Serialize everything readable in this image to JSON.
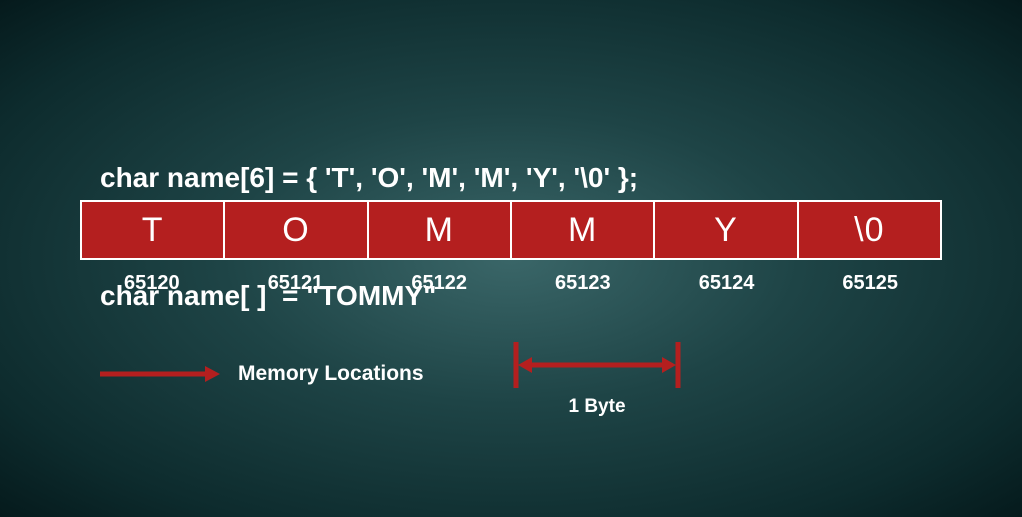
{
  "code": {
    "line1": "char name[6] = { 'T', 'O', 'M', 'M', 'Y', '\\0' };",
    "line2": "char name[ ]  = \"TOMMY\""
  },
  "cells": [
    "T",
    "O",
    "M",
    "M",
    "Y",
    "\\0"
  ],
  "addresses": [
    "65120",
    "65121",
    "65122",
    "65123",
    "65124",
    "65125"
  ],
  "legend": {
    "label": "Memory Locations"
  },
  "byte_span": {
    "label": "1 Byte"
  },
  "colors": {
    "cell_bg": "#b41f1f",
    "arrow": "#b41f1f"
  }
}
